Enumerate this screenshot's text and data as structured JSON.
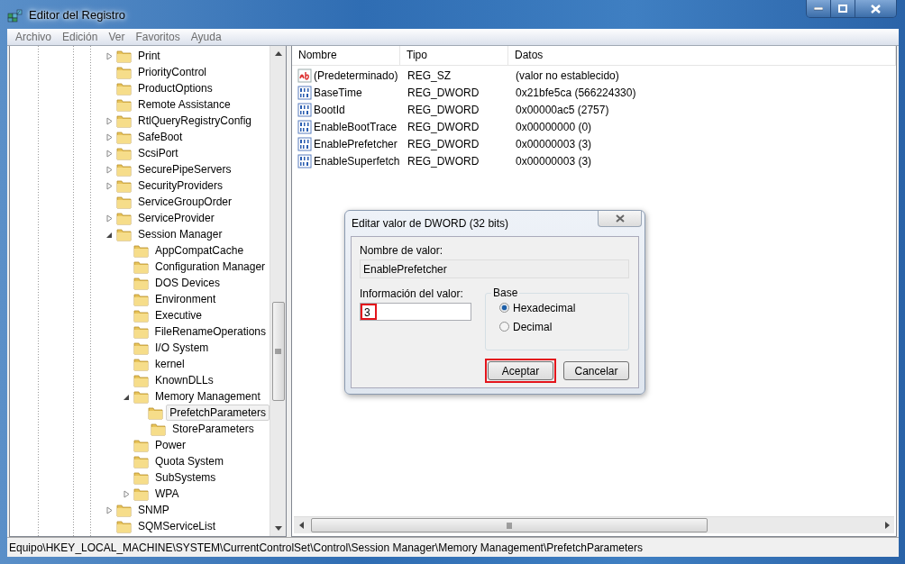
{
  "window": {
    "title": "Editor del Registro"
  },
  "menu": [
    "Archivo",
    "Edición",
    "Ver",
    "Favoritos",
    "Ayuda"
  ],
  "tree": [
    {
      "label": "Print",
      "expanded": false,
      "selected": false
    },
    {
      "label": "PriorityControl",
      "selected": false
    },
    {
      "label": "ProductOptions",
      "selected": false
    },
    {
      "label": "Remote Assistance",
      "selected": false
    },
    {
      "label": "RtlQueryRegistryConfig",
      "expanded": false,
      "selected": false
    },
    {
      "label": "SafeBoot",
      "expanded": false,
      "selected": false
    },
    {
      "label": "ScsiPort",
      "expanded": false,
      "selected": false
    },
    {
      "label": "SecurePipeServers",
      "expanded": false,
      "selected": false
    },
    {
      "label": "SecurityProviders",
      "expanded": false,
      "selected": false
    },
    {
      "label": "ServiceGroupOrder",
      "selected": false
    },
    {
      "label": "ServiceProvider",
      "expanded": false,
      "selected": false
    },
    {
      "label": "Session Manager",
      "expanded": true,
      "selected": false,
      "children": [
        {
          "label": "AppCompatCache",
          "selected": false
        },
        {
          "label": "Configuration Manager",
          "selected": false
        },
        {
          "label": "DOS Devices",
          "selected": false
        },
        {
          "label": "Environment",
          "selected": false
        },
        {
          "label": "Executive",
          "selected": false
        },
        {
          "label": "FileRenameOperations",
          "selected": false
        },
        {
          "label": "I/O System",
          "selected": false
        },
        {
          "label": "kernel",
          "selected": false
        },
        {
          "label": "KnownDLLs",
          "selected": false
        },
        {
          "label": "Memory Management",
          "expanded": true,
          "selected": false,
          "children": [
            {
              "label": "PrefetchParameters",
              "selected": true
            },
            {
              "label": "StoreParameters",
              "selected": false
            }
          ]
        },
        {
          "label": "Power",
          "selected": false
        },
        {
          "label": "Quota System",
          "selected": false
        },
        {
          "label": "SubSystems",
          "selected": false
        },
        {
          "label": "WPA",
          "expanded": false,
          "selected": false
        }
      ]
    },
    {
      "label": "SNMP",
      "expanded": false,
      "selected": false
    },
    {
      "label": "SQMServiceList",
      "selected": false
    }
  ],
  "list": {
    "columns": [
      "Nombre",
      "Tipo",
      "Datos"
    ],
    "rows": [
      {
        "kind": "string",
        "name": "(Predeterminado)",
        "type": "REG_SZ",
        "data": "(valor no establecido)",
        "selected": false
      },
      {
        "kind": "binary",
        "name": "BaseTime",
        "type": "REG_DWORD",
        "data": "0x21bfe5ca (566224330)",
        "selected": false
      },
      {
        "kind": "binary",
        "name": "BootId",
        "type": "REG_DWORD",
        "data": "0x00000ac5 (2757)",
        "selected": false
      },
      {
        "kind": "binary",
        "name": "EnableBootTrace",
        "type": "REG_DWORD",
        "data": "0x00000000 (0)",
        "selected": false
      },
      {
        "kind": "binary",
        "name": "EnablePrefetcher",
        "type": "REG_DWORD",
        "data": "0x00000003 (3)",
        "selected": false
      },
      {
        "kind": "binary",
        "name": "EnableSuperfetch",
        "type": "REG_DWORD",
        "data": "0x00000003 (3)",
        "selected": false
      }
    ]
  },
  "dialog": {
    "title": "Editar valor de DWORD (32 bits)",
    "name_label": "Nombre de valor:",
    "name_value": "EnablePrefetcher",
    "value_label": "Información del valor:",
    "value": "3",
    "value_highlighted": true,
    "base_label": "Base",
    "bases": [
      {
        "label": "Hexadecimal",
        "selected": true
      },
      {
        "label": "Decimal",
        "selected": false
      }
    ],
    "buttons": [
      {
        "label": "Aceptar",
        "highlighted": true
      },
      {
        "label": "Cancelar",
        "highlighted": false
      }
    ]
  },
  "status_bar": "Equipo\\HKEY_LOCAL_MACHINE\\SYSTEM\\CurrentControlSet\\Control\\Session Manager\\Memory Management\\PrefetchParameters"
}
